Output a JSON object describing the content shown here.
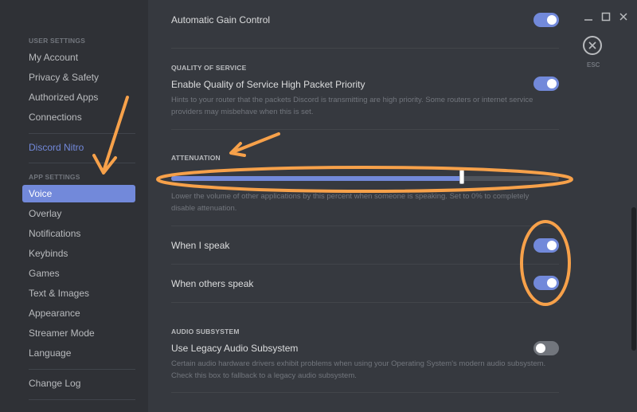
{
  "sidebar": {
    "user_settings_header": "USER SETTINGS",
    "user_items": [
      "My Account",
      "Privacy & Safety",
      "Authorized Apps",
      "Connections"
    ],
    "nitro": "Discord Nitro",
    "app_settings_header": "APP SETTINGS",
    "app_items": [
      "Voice",
      "Overlay",
      "Notifications",
      "Keybinds",
      "Games",
      "Text & Images",
      "Appearance",
      "Streamer Mode",
      "Language"
    ],
    "selected": "Voice",
    "change_log": "Change Log"
  },
  "main": {
    "agc": {
      "title": "Automatic Gain Control",
      "enabled": true
    },
    "qos": {
      "header": "QUALITY OF SERVICE",
      "title": "Enable Quality of Service High Packet Priority",
      "description": "Hints to your router that the packets Discord is transmitting are high priority. Some routers or internet service providers may misbehave when this is set.",
      "enabled": true
    },
    "attenuation": {
      "header": "ATTENUATION",
      "value_fraction": 0.75,
      "description_line1": "Lower the volume of other applications by this percent when someone is speaking. Set to 0% to completely",
      "description_line2": "disable attenuation."
    },
    "when_i_speak": {
      "title": "When I speak",
      "enabled": true
    },
    "when_others_speak": {
      "title": "When others speak",
      "enabled": true
    },
    "audio_subsystem": {
      "header": "AUDIO SUBSYSTEM",
      "title": "Use Legacy Audio Subsystem",
      "description_line1": "Certain audio hardware drivers exhibit problems when using your Operating System's modern audio subsystem.",
      "description_line2": "Check this box to fallback to a legacy audio subsystem.",
      "enabled": false
    }
  },
  "window": {
    "esc_label": "ESC",
    "minimize_icon": "minimize-icon",
    "maximize_icon": "maximize-icon",
    "close_icon": "close-icon"
  },
  "colors": {
    "accent": "#7289da",
    "annotation": "#f7a14a",
    "background": "#36393f",
    "sidebar": "#2f3136"
  }
}
